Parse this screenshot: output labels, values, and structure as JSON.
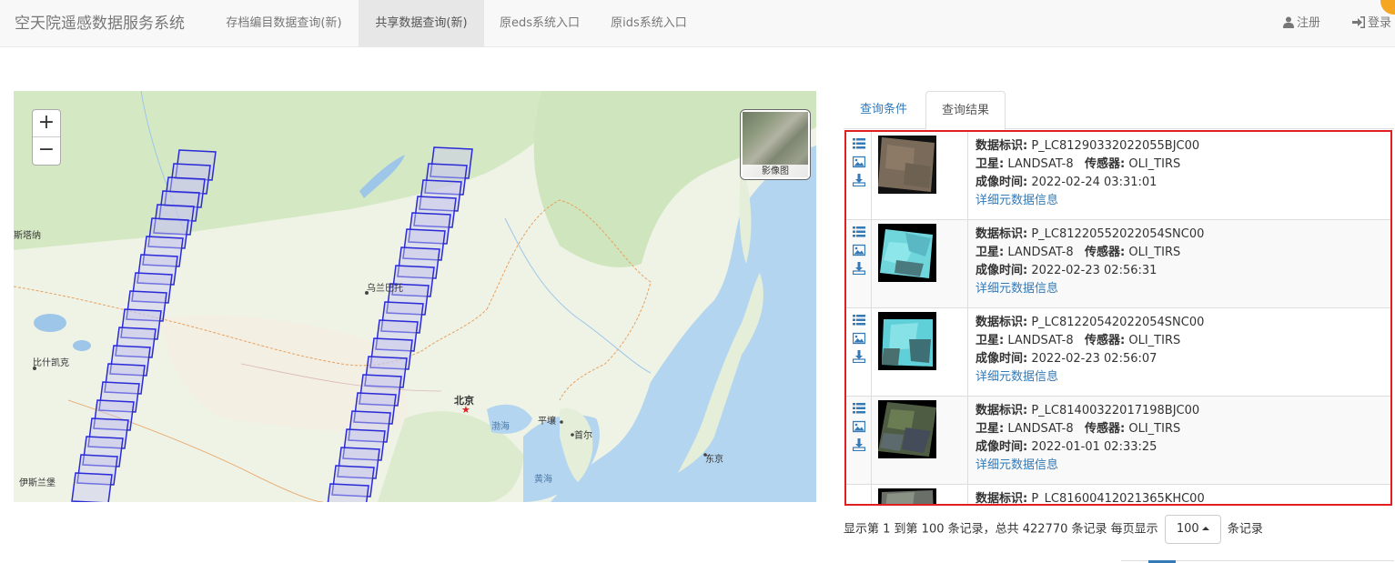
{
  "navbar": {
    "brand": "空天院遥感数据服务系统",
    "items": [
      {
        "label": "存档编目数据查询(新)",
        "active": false
      },
      {
        "label": "共享数据查询(新)",
        "active": true
      },
      {
        "label": "原eds系统入口",
        "active": false
      },
      {
        "label": "原ids系统入口",
        "active": false
      }
    ],
    "register": "注册",
    "login": "登录"
  },
  "map": {
    "zoom_in": "+",
    "zoom_out": "−",
    "layer_label": "影像图",
    "labels": [
      {
        "text": "斯塔纳",
        "style": "normal"
      },
      {
        "text": "乌兰巴托",
        "style": "normal"
      },
      {
        "text": "比什凯克",
        "style": "normal"
      },
      {
        "text": "北京",
        "style": "bold"
      },
      {
        "text": "渤海",
        "style": "sea"
      },
      {
        "text": "平壤",
        "style": "normal"
      },
      {
        "text": "首尔",
        "style": "normal"
      },
      {
        "text": "东京",
        "style": "normal"
      },
      {
        "text": "黄海",
        "style": "sea"
      },
      {
        "text": "伊斯兰堡",
        "style": "normal"
      }
    ],
    "capital_marker": "★"
  },
  "tabs": [
    {
      "label": "查询条件",
      "active": false
    },
    {
      "label": "查询结果",
      "active": true
    }
  ],
  "results": {
    "keys": {
      "id": "数据标识:",
      "satellite": "卫星:",
      "sensor": "传感器:",
      "time": "成像时间:"
    },
    "detail_link": "详细元数据信息",
    "rows": [
      {
        "id": "P_LC81290332022055BJC00",
        "satellite": "LANDSAT-8",
        "sensor": "OLI_TIRS",
        "time": "2022-02-24 03:31:01",
        "thumb": "brown"
      },
      {
        "id": "P_LC81220552022054SNC00",
        "satellite": "LANDSAT-8",
        "sensor": "OLI_TIRS",
        "time": "2022-02-23 02:56:31",
        "thumb": "cyan"
      },
      {
        "id": "P_LC81220542022054SNC00",
        "satellite": "LANDSAT-8",
        "sensor": "OLI_TIRS",
        "time": "2022-02-23 02:56:07",
        "thumb": "cyan"
      },
      {
        "id": "P_LC81400322017198BJC00",
        "satellite": "LANDSAT-8",
        "sensor": "OLI_TIRS",
        "time": "2022-01-01 02:33:25",
        "thumb": "green"
      },
      {
        "id": "P_LC81600412021365KHC00",
        "satellite": "",
        "sensor": "",
        "time": "",
        "thumb": "grey"
      }
    ]
  },
  "pager": {
    "prefix": "显示第 1 到第 100 条记录，总共 422770 条记录 每页显示",
    "page_size": "100",
    "suffix": "条记录"
  },
  "colors": {
    "link": "#337ab7",
    "highlight_border": "#e02020",
    "footprint": "#2b2bd6"
  }
}
